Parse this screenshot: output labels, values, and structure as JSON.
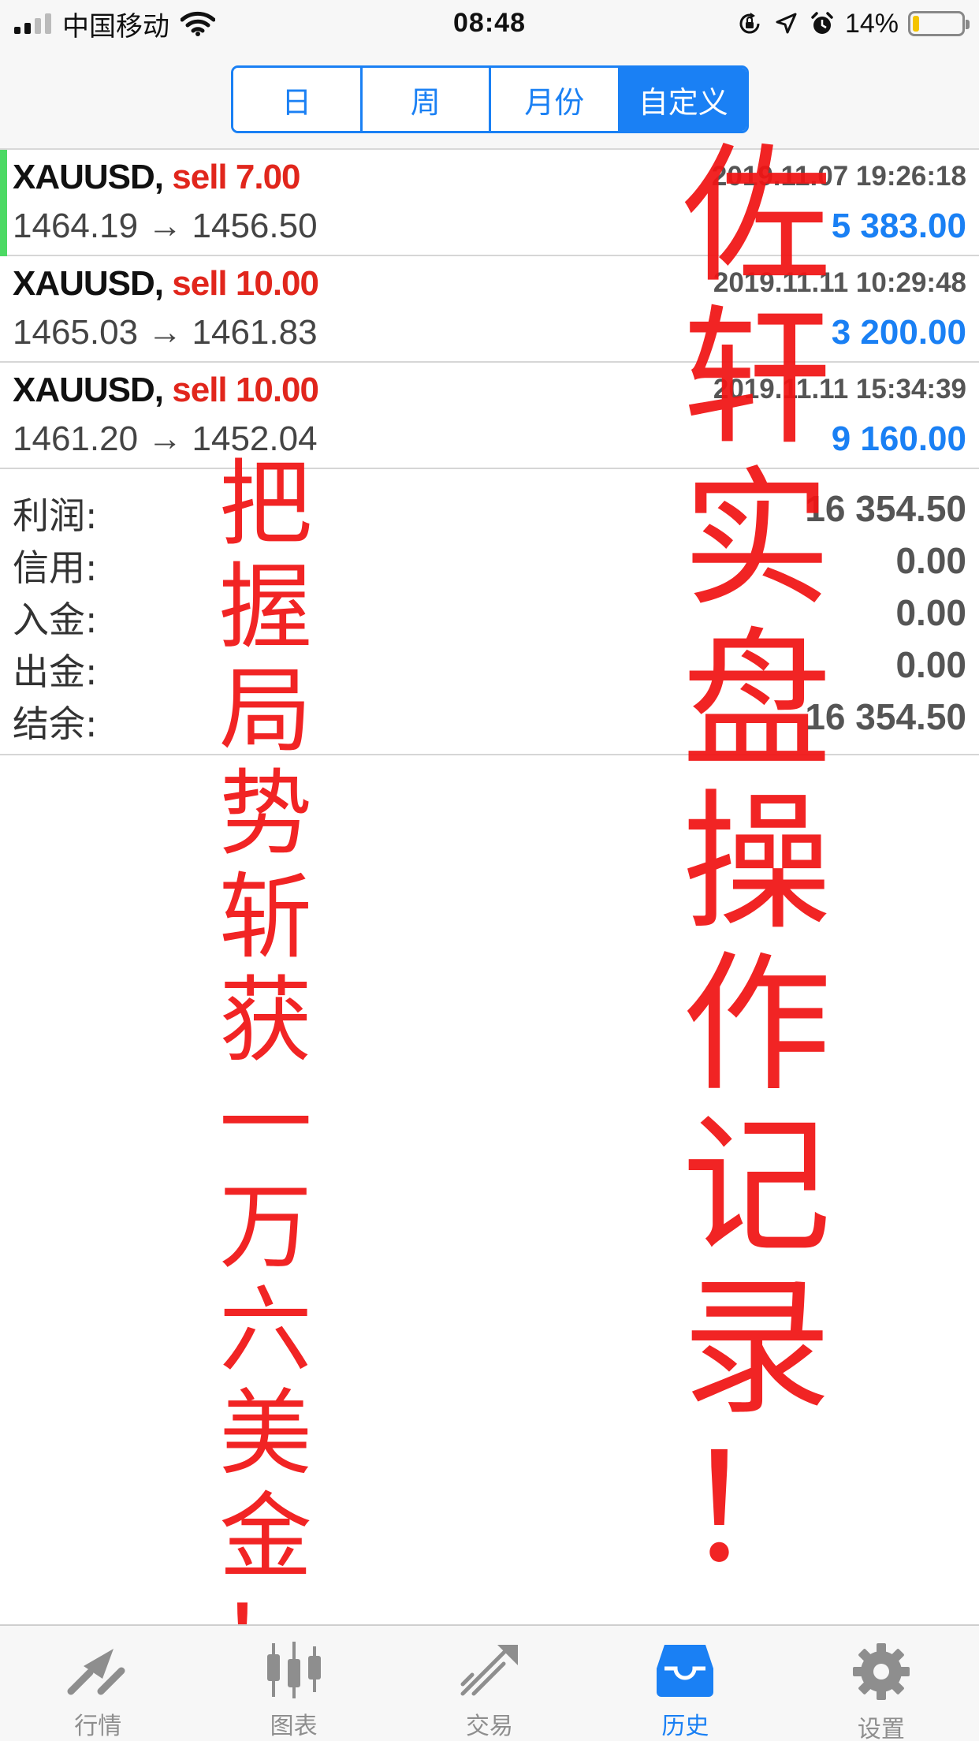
{
  "status_bar": {
    "carrier": "中国移动",
    "time": "08:48",
    "battery": "14%",
    "battery_level": 0.14
  },
  "period_tabs": [
    {
      "label": "日",
      "active": false
    },
    {
      "label": "周",
      "active": false
    },
    {
      "label": "月份",
      "active": false
    },
    {
      "label": "自定义",
      "active": true
    }
  ],
  "deals": [
    {
      "symbol": "XAUUSD,",
      "side": "sell 7.00",
      "prices": "1464.19 → 1456.50",
      "datetime": "2019.11.07 19:26:18",
      "profit": "5 383.00"
    },
    {
      "symbol": "XAUUSD,",
      "side": "sell 10.00",
      "prices": "1465.03 → 1461.83",
      "datetime": "2019.11.11 10:29:48",
      "profit": "3 200.00"
    },
    {
      "symbol": "XAUUSD,",
      "side": "sell 10.00",
      "prices": "1461.20 → 1452.04",
      "datetime": "2019.11.11 15:34:39",
      "profit": "9 160.00"
    }
  ],
  "summary": [
    {
      "label": "利润:",
      "value": "16 354.50"
    },
    {
      "label": "信用:",
      "value": "0.00"
    },
    {
      "label": "入金:",
      "value": "0.00"
    },
    {
      "label": "出金:",
      "value": "0.00"
    },
    {
      "label": "结余:",
      "value": "16 354.50"
    }
  ],
  "overlay_text": {
    "right": [
      "佐",
      "轩",
      "实",
      "盘",
      "操",
      "作",
      "记",
      "录",
      "！"
    ],
    "left": [
      "把",
      "握",
      "局",
      "势",
      "斩",
      "获",
      "一",
      "万",
      "六",
      "美",
      "金",
      "！"
    ]
  },
  "tab_bar": [
    {
      "label": "行情",
      "icon": "quotes-icon",
      "active": false
    },
    {
      "label": "图表",
      "icon": "chart-icon",
      "active": false
    },
    {
      "label": "交易",
      "icon": "trade-icon",
      "active": false
    },
    {
      "label": "历史",
      "icon": "history-icon",
      "active": true
    },
    {
      "label": "设置",
      "icon": "settings-icon",
      "active": false
    }
  ],
  "colors": {
    "accent": "#1a80f4",
    "sell": "#e1261c",
    "overlay": "#f11414",
    "marker": "#4cd964"
  }
}
